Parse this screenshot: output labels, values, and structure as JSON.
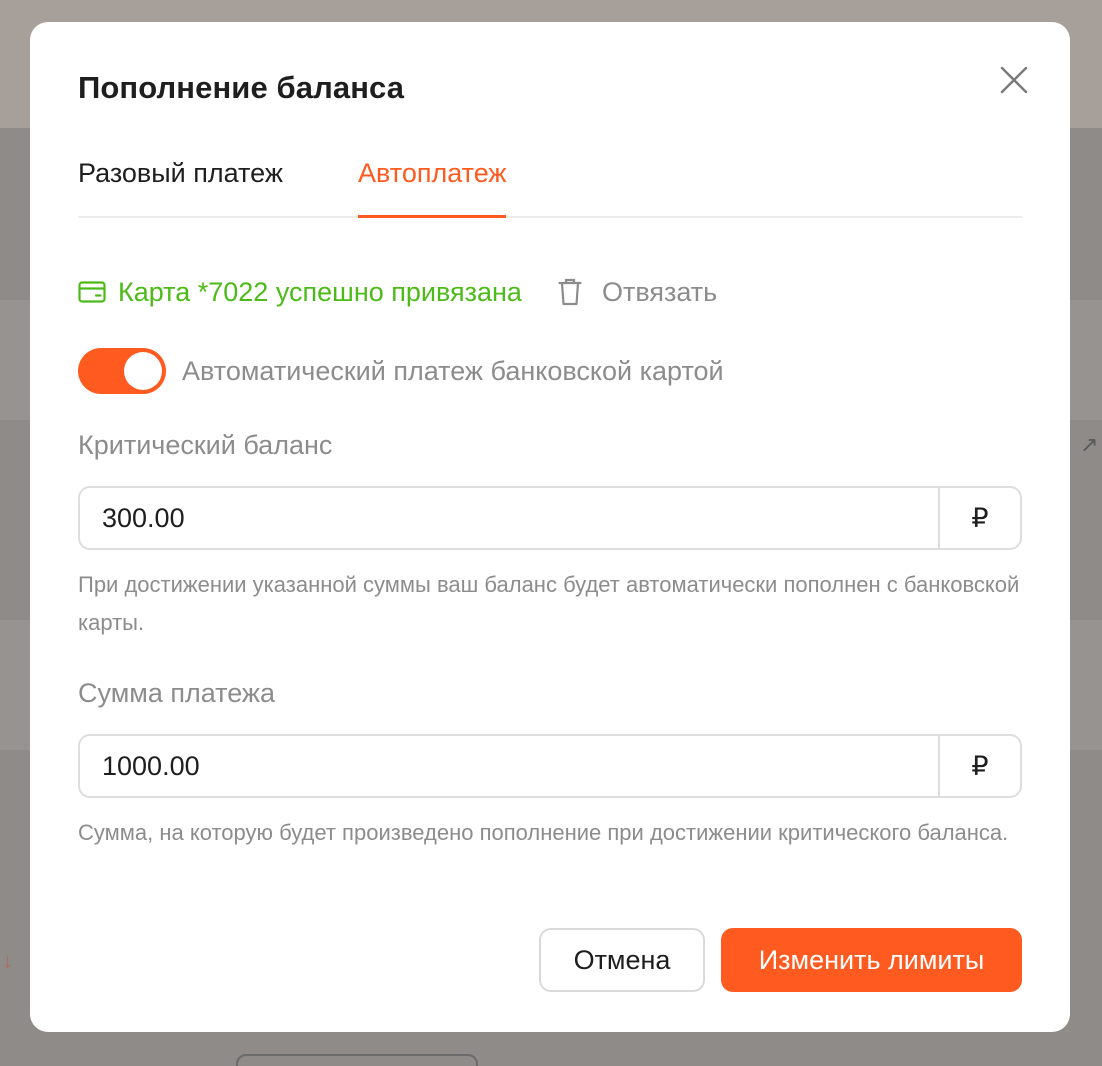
{
  "modal": {
    "title": "Пополнение баланса",
    "close_icon": "close-icon"
  },
  "tabs": [
    {
      "label": "Разовый платеж",
      "active": false
    },
    {
      "label": "Автоплатеж",
      "active": true
    }
  ],
  "card": {
    "status": "Карта *7022 успешно привязана",
    "status_color": "#4cbb17",
    "unbind_label": "Отвязать"
  },
  "autopay": {
    "toggle_on": true,
    "label": "Автоматический платеж банковской картой"
  },
  "critical_balance": {
    "label": "Критический баланс",
    "value": "300.00",
    "currency": "₽",
    "hint": "При достижении указанной суммы ваш баланс будет автоматически пополнен с банковской карты."
  },
  "payment_amount": {
    "label": "Сумма платежа",
    "value": "1000.00",
    "currency": "₽",
    "hint": "Сумма, на которую будет произведено пополнение при достижении критического баланса."
  },
  "buttons": {
    "cancel": "Отмена",
    "submit": "Изменить лимиты"
  },
  "colors": {
    "accent": "#ff5a1f",
    "success": "#4cbb17",
    "muted_text": "#8c8c8c"
  }
}
